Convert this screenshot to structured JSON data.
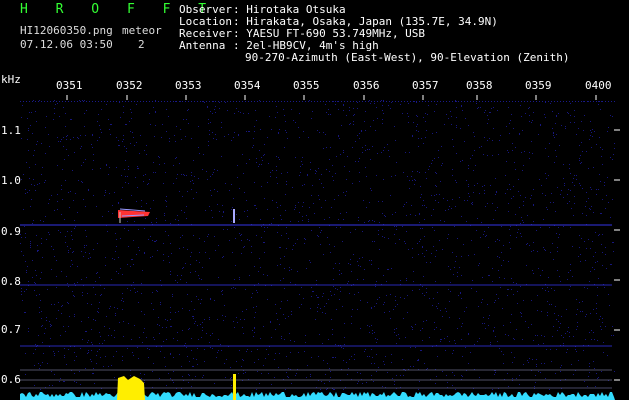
{
  "header": {
    "title": "H R O F F T",
    "filename": "HI12060350.png",
    "datetime": "07.12.06 03:50",
    "meteor_label": "meteor",
    "meteor_count": "2",
    "fields": [
      {
        "label": "Observer ",
        "value": ": Hirotaka Otsuka"
      },
      {
        "label": "Location ",
        "value": ": Hirakata, Osaka, Japan (135.7E, 34.9N)"
      },
      {
        "label": "Receiver ",
        "value": ": YAESU FT-690 53.749MHz, USB"
      },
      {
        "label": "Antenna  ",
        "value": ": 2el-HB9CV, 4m's high"
      }
    ],
    "antenna_line2": "90-270-Azimuth (East-West), 90-Elevation (Zenith)"
  },
  "axis": {
    "unit": "kHz",
    "time_ticks": [
      "0351",
      "0352",
      "0353",
      "0354",
      "0355",
      "0356",
      "0357",
      "0358",
      "0359",
      "0400"
    ],
    "freq_ticks": [
      "1.1",
      "1.0",
      "0.9",
      "0.8",
      "0.7",
      "0.6"
    ]
  },
  "colors": {
    "background": "#000000",
    "noise": "#1a1a8c",
    "line": "#3a3aff",
    "echo_red": "#ff3333",
    "signal_yellow": "#ffee00",
    "signal_cyan": "#33ddff",
    "axis_text": "#ffffff",
    "title_green": "#33ff33"
  }
}
